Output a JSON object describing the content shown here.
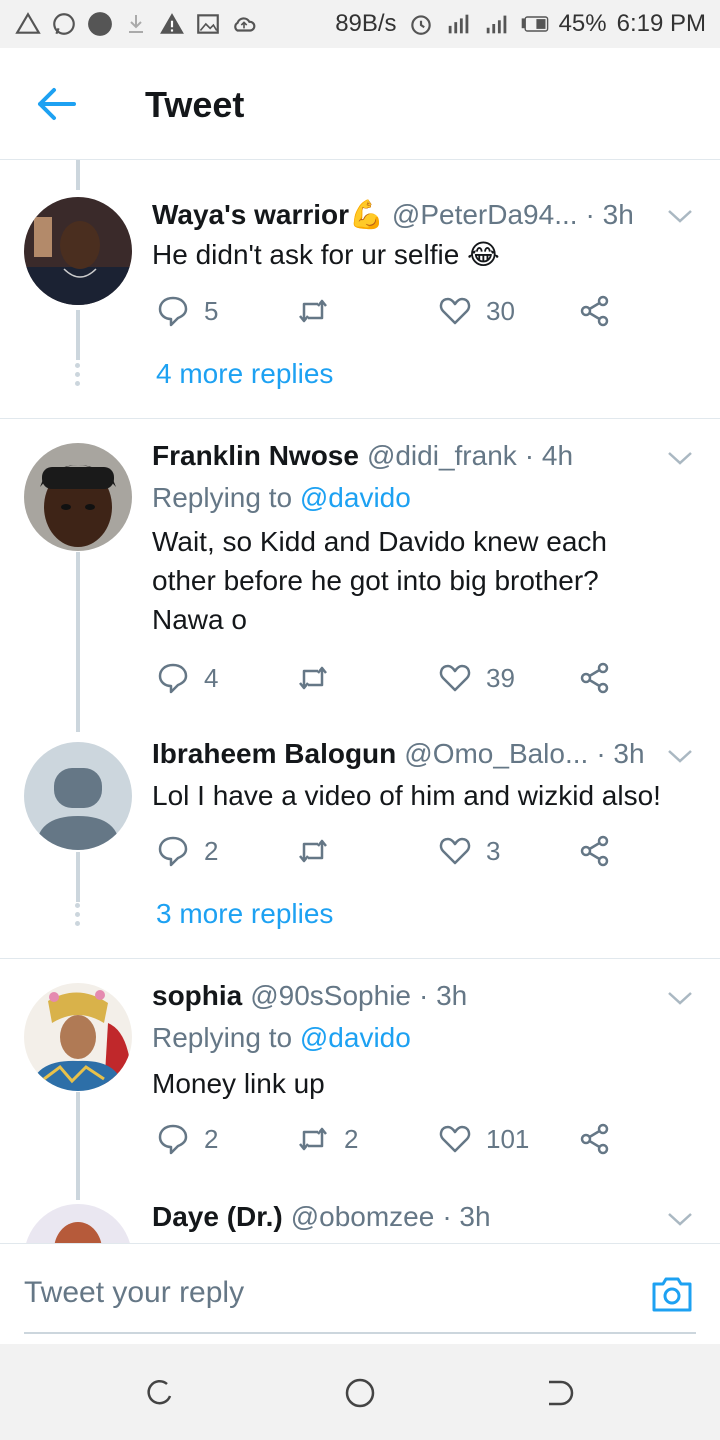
{
  "status_bar": {
    "speed": "89B/s",
    "battery": "45%",
    "time": "6:19 PM"
  },
  "header": {
    "title": "Tweet"
  },
  "tweets": [
    {
      "name": "Waya's warrior💪",
      "handle": "@PeterDa94...",
      "time": "· 3h",
      "text": "He didn't ask for ur selfie 😂",
      "replies": "5",
      "retweets": "",
      "likes": "30",
      "more_replies": "4 more replies"
    },
    {
      "name": "Franklin Nwose",
      "handle": "@didi_frank",
      "time": "· 4h",
      "replying_prefix": "Replying to",
      "replying_to": "@davido",
      "text": "Wait, so Kidd and Davido knew each other before he got into big brother? Nawa o",
      "replies": "4",
      "retweets": "",
      "likes": "39"
    },
    {
      "name": "Ibraheem Balogun",
      "handle": "@Omo_Balo...",
      "time": "· 3h",
      "text": "Lol I have a video of him and wizkid also!",
      "replies": "2",
      "retweets": "",
      "likes": "3",
      "more_replies": "3 more replies"
    },
    {
      "name": "sophia",
      "handle": "@90sSophie",
      "time": "· 3h",
      "replying_prefix": "Replying to",
      "replying_to": "@davido",
      "text": "Money link up",
      "replies": "2",
      "retweets": "2",
      "likes": "101"
    },
    {
      "name": "Daye (Dr.)",
      "handle": "@obomzee",
      "time": "· 3h"
    }
  ],
  "reply_bar": {
    "placeholder": "Tweet your reply"
  },
  "colors": {
    "accent": "#1da1f2",
    "secondary_text": "#657786",
    "divider": "#e1e8ed"
  }
}
